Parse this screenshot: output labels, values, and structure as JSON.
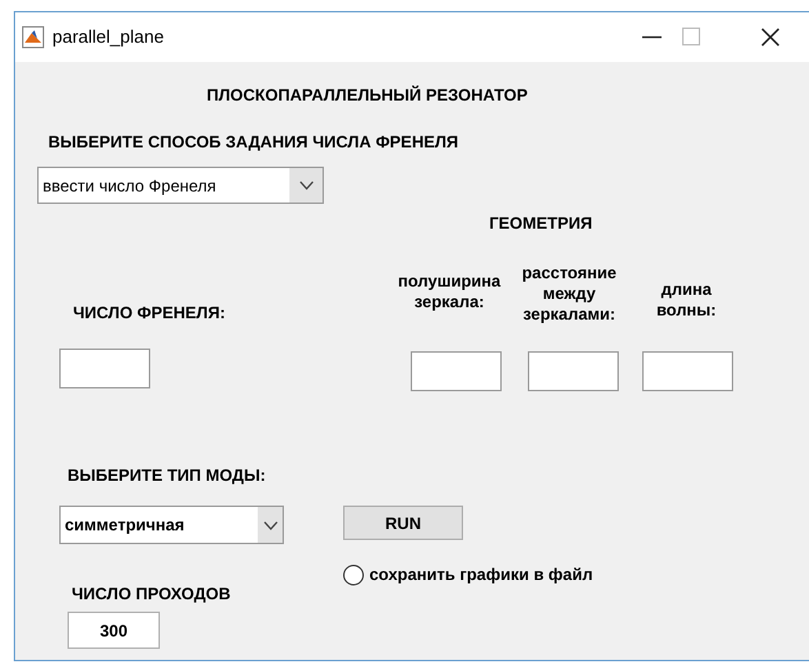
{
  "window": {
    "title": "parallel_plane"
  },
  "heading": "ПЛОСКОПАРАЛЛЕЛЬНЫЙ РЕЗОНАТОР",
  "fresnel_method": {
    "label": "ВЫБЕРИТЕ СПОСОБ ЗАДАНИЯ ЧИСЛА ФРЕНЕЛЯ",
    "value": "ввести число Френеля"
  },
  "fresnel_number": {
    "label": "ЧИСЛО ФРЕНЕЛЯ:"
  },
  "geometry": {
    "title": "ГЕОМЕТРИЯ",
    "fields": [
      {
        "label": "полуширина зеркала:"
      },
      {
        "label": "расстояние между зеркалами:"
      },
      {
        "label": "длина волны:"
      }
    ]
  },
  "mode": {
    "label": "ВЫБЕРИТЕ ТИП МОДЫ:",
    "value": "симметричная"
  },
  "run_button": "RUN",
  "save_plots": {
    "label": "сохранить графики в файл",
    "checked": false
  },
  "passes": {
    "label": "ЧИСЛО ПРОХОДОВ",
    "value": "300"
  }
}
